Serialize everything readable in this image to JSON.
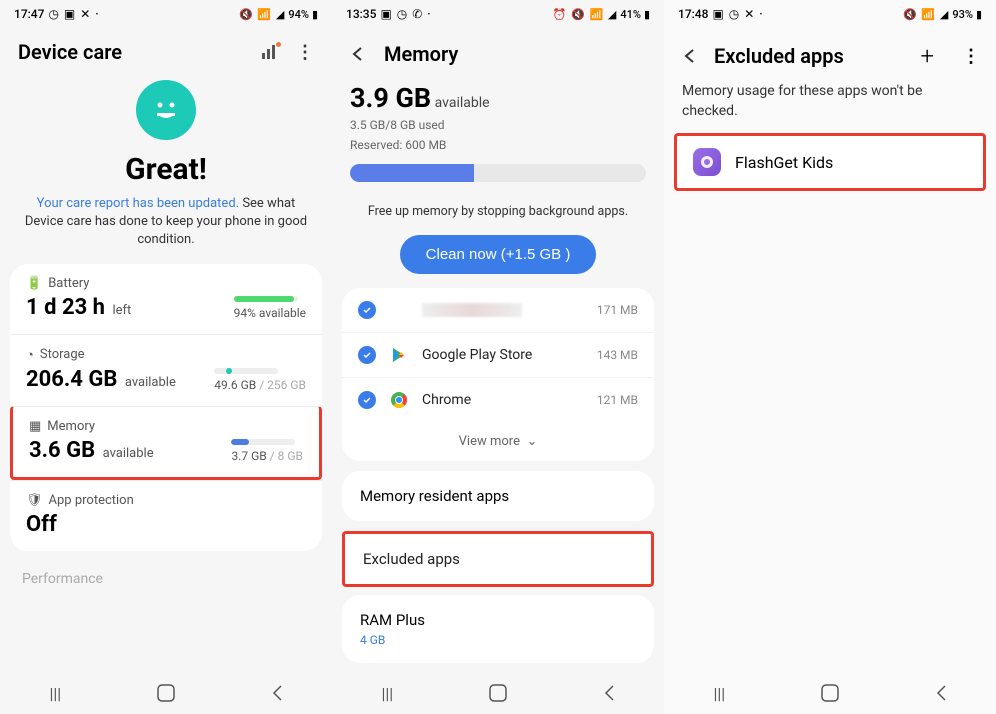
{
  "screen1": {
    "status": {
      "time": "17:47",
      "left_icons": "◷ ▣ ✕ ·",
      "right_icons": "🔇 📶 ◢",
      "battery": "94%"
    },
    "title": "Device care",
    "hero_status": "Great!",
    "desc_blue": "Your care report has been updated.",
    "desc_rest": " See what Device care has done to keep your phone in good condition.",
    "battery": {
      "label": "Battery",
      "value": "1 d 23 h",
      "unit": "left",
      "side": "94% available"
    },
    "storage": {
      "label": "Storage",
      "value": "206.4 GB",
      "unit": "available",
      "used": "49.6 GB",
      "total": " / 256 GB"
    },
    "memory": {
      "label": "Memory",
      "value": "3.6 GB",
      "unit": "available",
      "used": "3.7 GB",
      "total": " / 8 GB"
    },
    "protection": {
      "label": "App protection",
      "value": "Off"
    },
    "performance": "Performance"
  },
  "screen2": {
    "status": {
      "time": "13:35",
      "left_icons": "▣ ◷ ✆ ·",
      "right_icons": "⏰ 🔇 📶 ◢",
      "battery": "41%"
    },
    "title": "Memory",
    "avail_value": "3.9 GB",
    "avail_unit": " available",
    "used_line": "3.5 GB/8 GB used",
    "reserved_line": "Reserved: 600 MB",
    "free_text": "Free up memory by stopping background apps.",
    "clean_btn": "Clean now (+1.5 GB )",
    "apps": [
      {
        "name": "",
        "size": "171 MB",
        "icon": "blur"
      },
      {
        "name": "Google Play Store",
        "size": "143 MB",
        "icon": "play"
      },
      {
        "name": "Chrome",
        "size": "121 MB",
        "icon": "chrome"
      }
    ],
    "view_more": "View more",
    "resident": "Memory resident apps",
    "excluded": "Excluded apps",
    "ramplus": {
      "label": "RAM Plus",
      "value": "4 GB"
    }
  },
  "screen3": {
    "status": {
      "time": "17:48",
      "left_icons": "▣ ◷ ✕ ·",
      "right_icons": "🔇 📶 ◢",
      "battery": "93%"
    },
    "title": "Excluded apps",
    "desc": "Memory usage for these apps won't be checked.",
    "app_name": "FlashGet Kids"
  }
}
